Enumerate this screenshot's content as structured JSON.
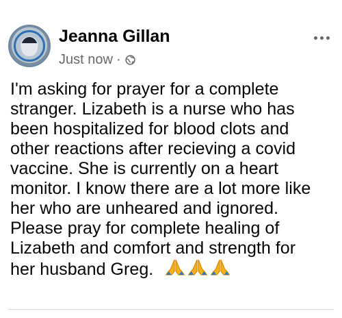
{
  "post": {
    "author_name": "Jeanna Gillan",
    "timestamp": "Just now",
    "separator": "·",
    "privacy_icon": "globe-icon",
    "more_options_icon": "more-options-icon",
    "message_lines": [
      "I'm asking for prayer for a complete",
      "stranger. Lizabeth is a nurse who has",
      "been hospitalized for blood clots and",
      "other reactions after recieving a covid",
      "vaccine. She is currently on a heart",
      "monitor. I know there are a lot more like",
      "her who are unheared and ignored.",
      "Please pray for complete healing of",
      "Lizabeth and comfort and strength for",
      "her husband Greg."
    ],
    "emoji_icons": [
      "praying-hands-icon",
      "praying-hands-icon",
      "praying-hands-icon"
    ]
  },
  "colors": {
    "primary_text": "#050505",
    "secondary_text": "#65676b",
    "divider": "#d3d6db"
  }
}
